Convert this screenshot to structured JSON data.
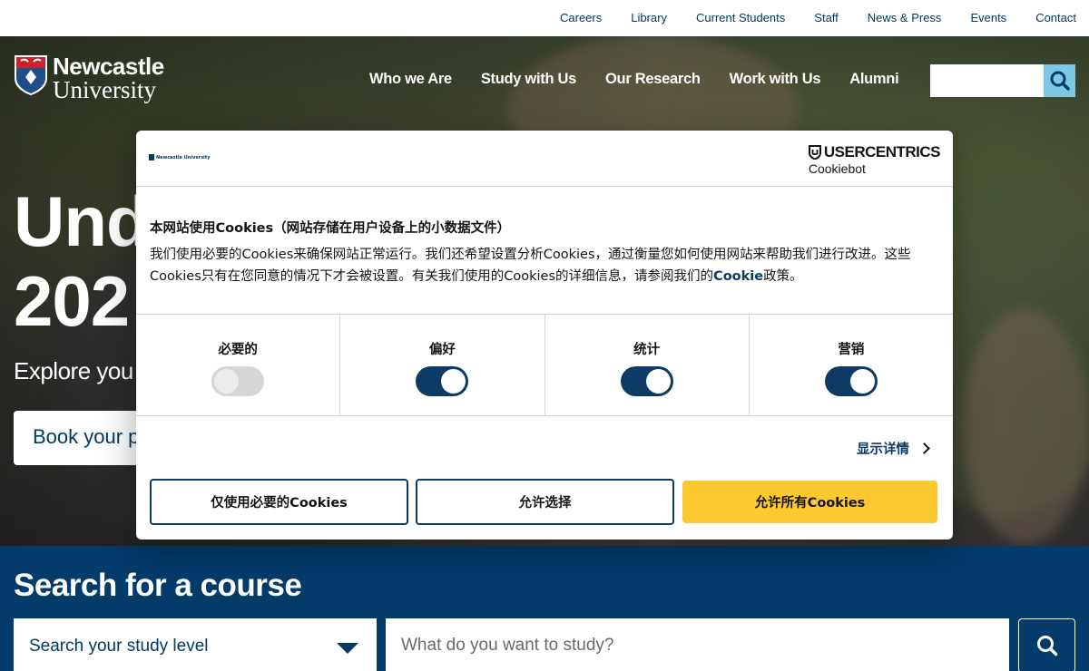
{
  "utility_nav": [
    "Careers",
    "Library",
    "Current Students",
    "Staff",
    "News & Press",
    "Events",
    "Contact"
  ],
  "logo": {
    "line1": "Newcastle",
    "line2": "University"
  },
  "main_nav": [
    "Who we Are",
    "Study with Us",
    "Our Research",
    "Work with Us",
    "Alumni"
  ],
  "hero": {
    "headline_line1": "Und",
    "headline_line2": "202",
    "subline": "Explore you",
    "book_button": "Book your pl"
  },
  "course_search": {
    "title": "Search for a course",
    "level_select": "Search your study level",
    "study_placeholder": "What do you want to study?"
  },
  "cookie_dialog": {
    "brand_line1": "USERCENTRICS",
    "brand_line2": "Cookiebot",
    "mini_logo": "Newcastle University",
    "title": "本网站使用Cookies（网站存储在用户设备上的小数据文件）",
    "body_part1": "我们使用必要的Cookies来确保网站正常运行。我们还希望设置分析Cookies，通过衡量您如何使用网站来帮助我们进行改进。这些Cookies只有在您同意的情况下才会被设置。有关我们使用的Cookies的详细信息，请参阅我们的",
    "body_link": "Cookie",
    "body_part2": "政策。",
    "categories": [
      {
        "label": "必要的",
        "enabled": true,
        "disabled": true
      },
      {
        "label": "偏好",
        "enabled": true,
        "disabled": false
      },
      {
        "label": "统计",
        "enabled": true,
        "disabled": false
      },
      {
        "label": "营销",
        "enabled": true,
        "disabled": false
      }
    ],
    "show_details": "显示详情",
    "buttons": {
      "necessary_only": "仅使用必要的Cookies",
      "allow_selection": "允许选择",
      "allow_all": "允许所有Cookies"
    }
  },
  "colors": {
    "navy": "#033b6b",
    "accent_yellow": "#fdc930",
    "search_blue": "#7ec8e3"
  }
}
